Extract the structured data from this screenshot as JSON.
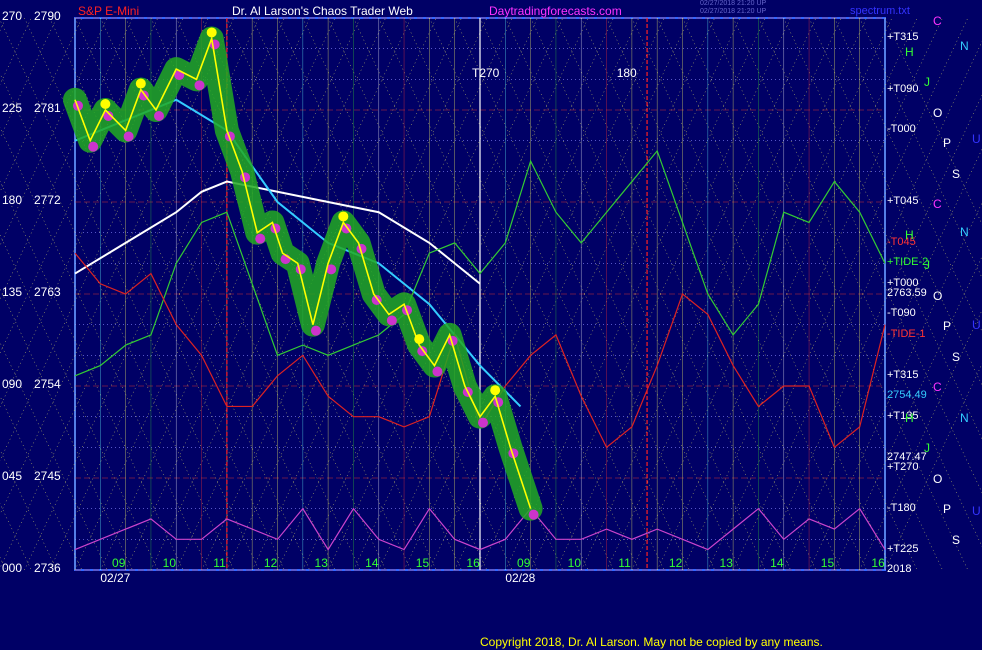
{
  "header": {
    "instrument": "S&P E-Mini",
    "title": "Dr. Al Larson's Chaos Trader Web",
    "site": "Daytradingforecasts.com",
    "stamp_line1": "02/27/2018 21:20 UP",
    "stamp_line2": "02/27/2018 21:20 UP",
    "spectrum": "spectrum.txt"
  },
  "footer": {
    "copyright": "Copyright 2018, Dr. Al Larson. May not be copied by any means."
  },
  "colors": {
    "background": "#000066",
    "plot_border": "#3366ff",
    "price_path": "#ffff00",
    "green_glow": "#22aa22",
    "magenta_dots": "#cc33cc",
    "cyan_avg": "#33ccff",
    "white_avg": "#ffffff",
    "eo_green": "#33cc33",
    "eo_red": "#dd2222",
    "eo_magenta": "#cc44cc"
  },
  "chart_data": {
    "type": "line",
    "title": "S&P E-Mini",
    "y_price_range": [
      2736,
      2790
    ],
    "y_angle_range": [
      0,
      270
    ],
    "y_left_angle_labels": [
      "270",
      "225",
      "180",
      "135",
      "090",
      "045",
      "000"
    ],
    "y_left_price_labels": [
      "2790",
      "2781",
      "2772",
      "2763",
      "2754",
      "2745",
      "2736"
    ],
    "x_hour_labels": [
      "09",
      "10",
      "11",
      "12",
      "13",
      "14",
      "15",
      "16",
      "09",
      "10",
      "11",
      "12",
      "13",
      "14",
      "15",
      "16"
    ],
    "x_date_labels": [
      "02/27",
      "02/28"
    ],
    "series": [
      {
        "type": "price",
        "x": [
          0,
          0.3,
          0.6,
          1.0,
          1.3,
          1.6,
          2.0,
          2.4,
          2.7,
          3.0,
          3.3,
          3.6,
          3.9,
          4.1,
          4.4,
          4.7,
          5.0,
          5.3,
          5.6,
          5.9,
          6.2,
          6.5,
          6.8,
          7.1,
          7.4,
          7.7,
          8.0,
          8.3,
          8.6,
          9.0
        ],
        "y": [
          2782,
          2778,
          2781,
          2779,
          2783,
          2781,
          2785,
          2784,
          2788,
          2779,
          2775,
          2769,
          2770,
          2767,
          2766,
          2760,
          2766,
          2770,
          2768,
          2763,
          2761,
          2762,
          2758,
          2756,
          2759,
          2754,
          2751,
          2753,
          2748,
          2742
        ]
      },
      {
        "name": "+TIDE-2",
        "type": "line",
        "x": [
          0,
          0.5,
          1.0,
          1.5,
          2.0,
          2.5,
          3.0,
          3.5,
          4.0,
          4.5,
          5.0,
          5.5,
          6.0,
          6.5,
          7.0,
          7.5,
          8.0,
          8.5,
          9.0,
          9.5,
          10.0,
          10.5,
          11.0,
          11.5,
          12.0,
          12.5,
          13.0,
          13.5,
          14.0,
          14.5,
          15.0,
          15.5,
          16.0
        ],
        "y": [
          2755,
          2756,
          2758,
          2759,
          2766,
          2770,
          2771,
          2764,
          2757,
          2758,
          2757,
          2758,
          2759,
          2761,
          2767,
          2768,
          2765,
          2768,
          2776,
          2771,
          2768,
          2771,
          2774,
          2777,
          2770,
          2763,
          2759,
          2762,
          2771,
          2770,
          2774,
          2771,
          2766
        ]
      },
      {
        "name": "-TIDE-1",
        "type": "line",
        "x": [
          0,
          0.5,
          1.0,
          1.5,
          2.0,
          2.5,
          3.0,
          3.5,
          4.0,
          4.5,
          5.0,
          5.5,
          6.0,
          6.5,
          7.0,
          7.5,
          8.0,
          8.5,
          9.0,
          9.5,
          10.0,
          10.5,
          11.0,
          11.5,
          12.0,
          12.5,
          13.0,
          13.5,
          14.0,
          14.5,
          15.0,
          15.5,
          16.0
        ],
        "y": [
          2767,
          2764,
          2763,
          2765,
          2760,
          2757,
          2752,
          2752,
          2755,
          2757,
          2753,
          2751,
          2751,
          2750,
          2751,
          2759,
          2750,
          2754,
          2757,
          2759,
          2753,
          2748,
          2750,
          2756,
          2763,
          2761,
          2756,
          2752,
          2754,
          2754,
          2748,
          2750,
          2760
        ]
      },
      {
        "name": "TIDE",
        "type": "line",
        "x": [
          0,
          0.5,
          1.0,
          1.5,
          2.0,
          2.5,
          3.0,
          3.5,
          4.0,
          4.5,
          5.0,
          5.5,
          6.0,
          6.5,
          7.0,
          7.5,
          8.0,
          8.5,
          9.0,
          9.5,
          10.0,
          10.5,
          11.0,
          11.5,
          12.0,
          12.5,
          13.0,
          13.5,
          14.0,
          14.5,
          15.0,
          15.5,
          16.0
        ],
        "y": [
          2738,
          2739,
          2740,
          2741,
          2739,
          2739,
          2741,
          2740,
          2739,
          2742,
          2738,
          2742,
          2739,
          2738,
          2742,
          2739,
          2738,
          2739,
          2742,
          2739,
          2739,
          2740,
          2739,
          2740,
          2739,
          2738,
          2740,
          2742,
          2739,
          2741,
          2740,
          2742,
          2738
        ]
      }
    ],
    "averages": [
      {
        "type": "white_avg",
        "x": [
          0,
          1,
          2,
          2.5,
          3,
          4,
          5,
          6,
          7,
          8
        ],
        "y": [
          2765,
          2768,
          2771,
          2773,
          2774,
          2773,
          2772,
          2771,
          2768,
          2764
        ]
      },
      {
        "type": "cyan_avg",
        "x": [
          0,
          1,
          2,
          3,
          4,
          5,
          6,
          7,
          8,
          8.8
        ],
        "y": [
          2778,
          2780,
          2782,
          2779,
          2772,
          2768,
          2766,
          2762,
          2756,
          2752
        ]
      }
    ],
    "right_labels": [
      {
        "text": "+T315",
        "y": 2788,
        "color": "#ffffff"
      },
      {
        "text": "+T090",
        "y": 2783,
        "color": "#ffffff"
      },
      {
        "text": "-T000",
        "y": 2779,
        "color": "#ffffff"
      },
      {
        "text": "+T045",
        "y": 2772,
        "color": "#ffffff"
      },
      {
        "text": "-T045",
        "y": 2768,
        "color": "#ff3333"
      },
      {
        "text": "+TIDE-2",
        "y": 2766,
        "color": "#33ff33"
      },
      {
        "text": "+T000",
        "y": 2764,
        "color": "#ffffff"
      },
      {
        "text": "2763.59",
        "y": 2763,
        "color": "#ffffff"
      },
      {
        "text": "-T090",
        "y": 2761,
        "color": "#ffffff"
      },
      {
        "text": "-TIDE-1",
        "y": 2759,
        "color": "#ff3333"
      },
      {
        "text": "+T315",
        "y": 2755,
        "color": "#ffffff"
      },
      {
        "text": "2754.49",
        "y": 2753,
        "color": "#33ccff"
      },
      {
        "text": "+T135",
        "y": 2751,
        "color": "#ffffff"
      },
      {
        "text": "2747.47",
        "y": 2747,
        "color": "#ffffff"
      },
      {
        "text": "+T270",
        "y": 2746,
        "color": "#ffffff"
      },
      {
        "text": "-T180",
        "y": 2742,
        "color": "#ffffff"
      },
      {
        "text": "+T225",
        "y": 2738,
        "color": "#ffffff"
      },
      {
        "text": "2018",
        "y": 2736,
        "color": "#ffffff"
      }
    ],
    "letter_column": [
      "C",
      "H",
      "J",
      "O",
      "P",
      "S",
      "C",
      "H",
      "J",
      "O",
      "P",
      "S",
      "C",
      "H",
      "J",
      "O",
      "P",
      "S"
    ],
    "far_right_letters": [
      "N",
      "U",
      "N",
      "U",
      "N",
      "U"
    ],
    "top_markers": [
      "T270",
      "180"
    ],
    "grid": true,
    "legend": "right"
  }
}
